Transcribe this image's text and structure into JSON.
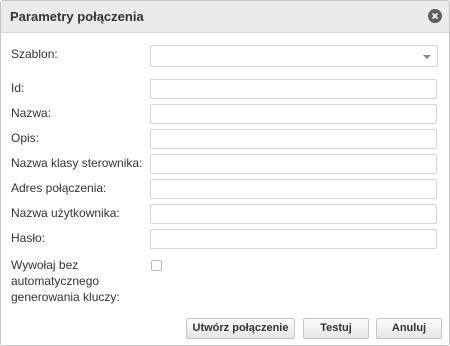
{
  "dialog": {
    "title": "Parametry połączenia",
    "close_icon": "close-circle-icon"
  },
  "form": {
    "template": {
      "label": "Szablon:",
      "value": ""
    },
    "id": {
      "label": "Id:",
      "value": ""
    },
    "name": {
      "label": "Nazwa:",
      "value": ""
    },
    "description": {
      "label": "Opis:",
      "value": ""
    },
    "driver_class": {
      "label": "Nazwa klasy sterownika:",
      "value": ""
    },
    "connection_url": {
      "label": "Adres połączenia:",
      "value": ""
    },
    "username": {
      "label": "Nazwa użytkownika:",
      "value": ""
    },
    "password": {
      "label": "Hasło:",
      "value": ""
    },
    "no_keygen": {
      "label_lines": [
        "Wywołaj bez",
        "automatycznego",
        "generowania kluczy:"
      ],
      "checked": false
    }
  },
  "buttons": {
    "create": "Utwórz połączenie",
    "test": "Testuj",
    "cancel": "Anuluj"
  }
}
